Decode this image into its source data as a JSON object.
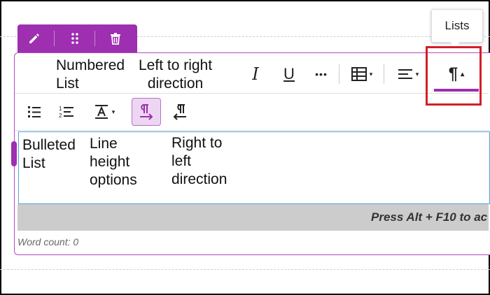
{
  "floating_toolbar": {
    "items": [
      {
        "name": "pencil-icon"
      },
      {
        "name": "drag-handle-icon"
      },
      {
        "name": "trash-icon"
      }
    ]
  },
  "annotations": {
    "numbered_list": "Numbered\nList",
    "left_to_right": "Left to right\ndirection",
    "bulleted_list": "Bulleted\nList",
    "line_height": "Line\nheight\noptions",
    "right_to_left": "Right to\nleft\ndirection"
  },
  "toolbar_row1": {
    "italic": "I",
    "underline": "U",
    "more": "•••",
    "paragraph": "¶"
  },
  "tooltip": {
    "text": "Lists"
  },
  "status_bar": {
    "text": "Press Alt + F10 to ac"
  },
  "word_count": "Word count: 0",
  "colors": {
    "accent": "#9d2fb0",
    "highlight": "#d21f26",
    "focus_border": "#4ba3e0"
  }
}
